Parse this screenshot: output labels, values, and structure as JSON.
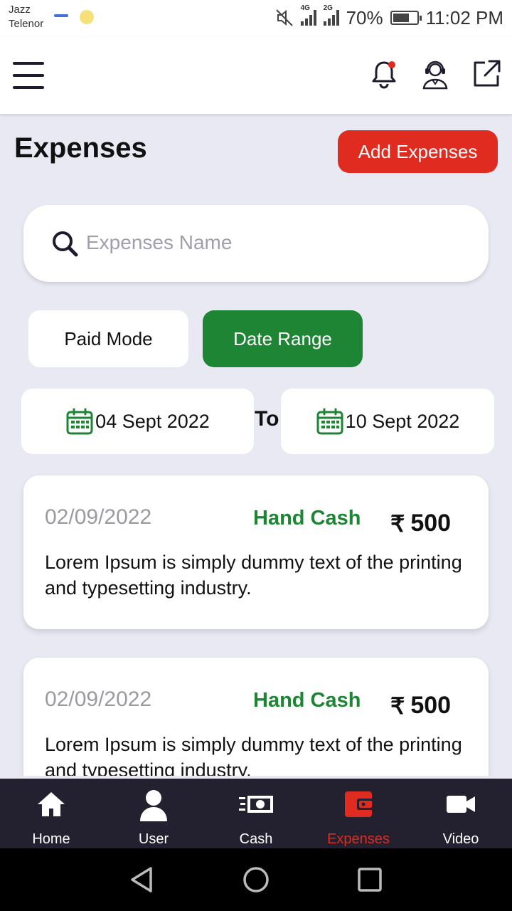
{
  "status_bar": {
    "carrier_1": "Jazz",
    "carrier_2": "Telenor",
    "net_1": "4G",
    "net_2": "2G",
    "battery": "70%",
    "battery_level": 0.7,
    "time": "11:02 PM"
  },
  "header": {
    "menu_icon": "hamburger-menu-icon",
    "notification_icon": "bell-icon",
    "support_icon": "support-agent-icon",
    "share_icon": "external-link-icon",
    "accent": "#e02b20"
  },
  "page": {
    "title": "Expenses",
    "add_button": "Add Expenses"
  },
  "search": {
    "placeholder": "Expenses Name",
    "value": ""
  },
  "filters": {
    "paid_mode": "Paid Mode",
    "date_range": "Date Range",
    "active": "date_range",
    "active_color": "#1e8535"
  },
  "date_range": {
    "from": "04 Sept 2022",
    "to_label": "To",
    "to": "10 Sept 2022"
  },
  "expenses": [
    {
      "date": "02/09/2022",
      "mode": "Hand Cash",
      "currency_symbol": "₹",
      "amount": "500",
      "description": "Lorem Ipsum is simply dummy text of the printing and typesetting industry."
    },
    {
      "date": "02/09/2022",
      "mode": "Hand Cash",
      "currency_symbol": "₹",
      "amount": "500",
      "description": "Lorem Ipsum is simply dummy text of the printing and typesetting industry."
    }
  ],
  "bottom_nav": {
    "items": [
      {
        "label": "Home",
        "icon": "home-icon"
      },
      {
        "label": "User",
        "icon": "user-icon"
      },
      {
        "label": "Cash",
        "icon": "cash-icon"
      },
      {
        "label": "Expenses",
        "icon": "wallet-icon"
      },
      {
        "label": "Video",
        "icon": "video-camera-icon"
      }
    ],
    "active": "Expenses"
  }
}
